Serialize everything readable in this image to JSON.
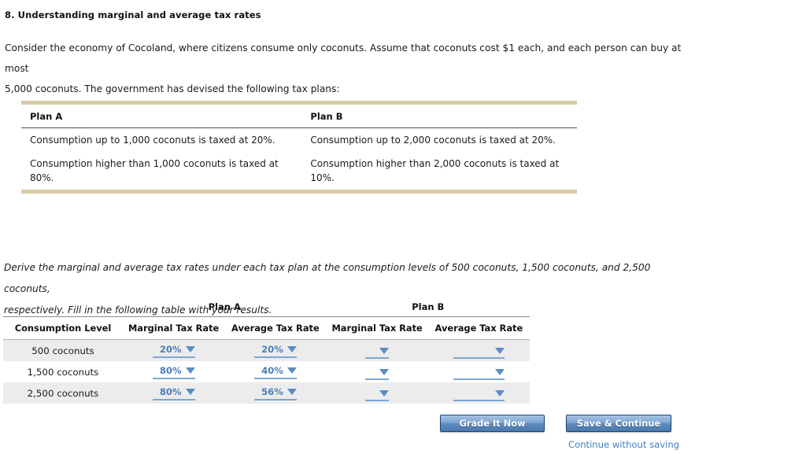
{
  "question": {
    "title": "8. Understanding marginal and average tax rates",
    "intro_line1": "Consider the economy of Cocoland, where citizens consume only coconuts. Assume that coconuts cost $1 each, and each person can buy at most",
    "intro_line2": "5,000 coconuts. The government has devised the following tax plans:",
    "derive_line1": "Derive the marginal and average tax rates under each tax plan at the consumption levels of 500 coconuts, 1,500 coconuts, and 2,500 coconuts,",
    "derive_line2": "respectively. Fill in the following table with your results."
  },
  "plan_table": {
    "headers": [
      "Plan A",
      "Plan B"
    ],
    "rows": [
      [
        "Consumption up to 1,000 coconuts is taxed at 20%.",
        "Consumption up to 2,000 coconuts is taxed at 20%."
      ],
      [
        "Consumption higher than 1,000 coconuts is taxed at 80%.",
        "Consumption higher than 2,000 coconuts is taxed at 10%."
      ]
    ],
    "border_color": "#d6cba2"
  },
  "results_table": {
    "group_headers": [
      "Plan A",
      "Plan B"
    ],
    "column_headers": [
      "Consumption Level",
      "Marginal Tax Rate",
      "Average Tax Rate",
      "Marginal Tax Rate",
      "Average Tax Rate"
    ],
    "rows": [
      {
        "level": "500 coconuts",
        "plan_a_marginal": "20%",
        "plan_a_average": "20%",
        "plan_b_marginal": "",
        "plan_b_average": ""
      },
      {
        "level": "1,500 coconuts",
        "plan_a_marginal": "80%",
        "plan_a_average": "40%",
        "plan_b_marginal": "",
        "plan_b_average": ""
      },
      {
        "level": "2,500 coconuts",
        "plan_a_marginal": "80%",
        "plan_a_average": "56%",
        "plan_b_marginal": "",
        "plan_b_average": ""
      }
    ],
    "dropdown_color": "#4a7ebb",
    "row_shade_color": "#ececec"
  },
  "actions": {
    "grade_label": "Grade It Now",
    "save_label": "Save & Continue",
    "continue_link": "Continue without saving",
    "button_accent": "#5e8cc0",
    "link_color": "#3f7fc1"
  }
}
